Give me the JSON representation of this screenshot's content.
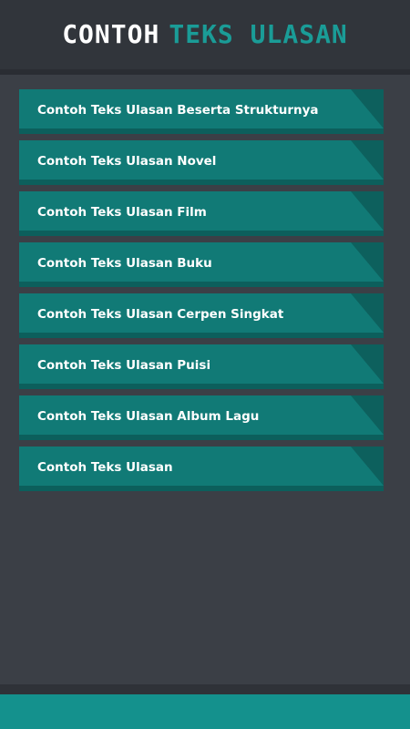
{
  "header": {
    "title_part1": "CONTOH",
    "title_part2": "TEKS ULASAN"
  },
  "menu": {
    "items": [
      {
        "label": "Contoh Teks Ulasan Beserta Strukturnya"
      },
      {
        "label": "Contoh Teks Ulasan Novel"
      },
      {
        "label": "Contoh Teks Ulasan Film"
      },
      {
        "label": "Contoh Teks Ulasan Buku"
      },
      {
        "label": "Contoh Teks Ulasan Cerpen Singkat"
      },
      {
        "label": "Contoh Teks Ulasan Puisi"
      },
      {
        "label": "Contoh Teks Ulasan Album Lagu"
      },
      {
        "label": "Contoh Teks Ulasan"
      }
    ]
  },
  "colors": {
    "background": "#3b3f46",
    "header": "#31353b",
    "accent": "#1a9c97",
    "item": "#117a76",
    "item_shadow": "#0c5f5c",
    "bottom_bar": "#14918d"
  }
}
